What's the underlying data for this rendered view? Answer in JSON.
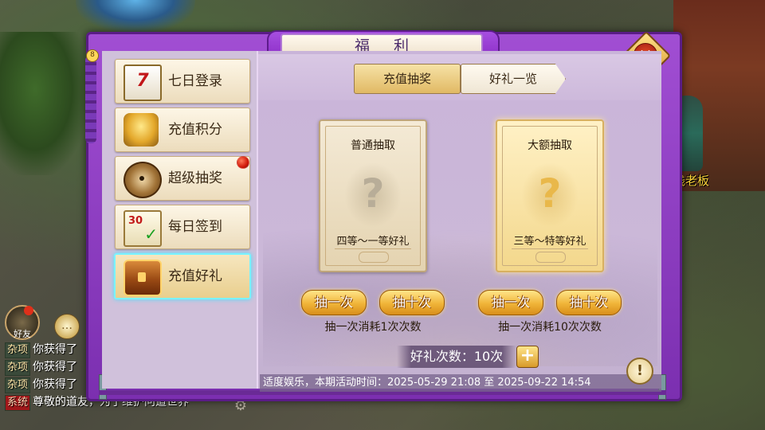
{
  "background": {
    "npc_name": "客栈老板",
    "chat_lines": [
      {
        "tag": "杂项",
        "text": "你获得了"
      },
      {
        "tag": "杂项",
        "text": "你获得了"
      },
      {
        "tag": "杂项",
        "text": "你获得了"
      },
      {
        "tag": "系统",
        "text": "尊敬的道友，为了维护问道世界"
      }
    ],
    "friend_label": "好友"
  },
  "window": {
    "title": "福 利",
    "close_icon": "close-icon",
    "tassel_badge": "8"
  },
  "sidebar": {
    "items": [
      {
        "label": "七日登录",
        "icon": "calendar-7-icon",
        "calendar_text": "7"
      },
      {
        "label": "充值积分",
        "icon": "gold-ingot-icon"
      },
      {
        "label": "超级抽奖",
        "icon": "compass-wheel-icon",
        "has_alert": true
      },
      {
        "label": "每日签到",
        "icon": "sign-in-calendar-icon",
        "calendar_text": "30"
      },
      {
        "label": "充值好礼",
        "icon": "treasure-chest-icon",
        "selected": true
      }
    ]
  },
  "tabs": [
    {
      "label": "充值抽奖",
      "active": true
    },
    {
      "label": "好礼一览",
      "active": false
    }
  ],
  "cards": [
    {
      "title": "普通抽取",
      "subtitle": "四等～一等好礼",
      "question_mark": "?",
      "buttons": [
        "抽一次",
        "抽十次"
      ],
      "cost_text": "抽一次消耗1次次数"
    },
    {
      "title": "大额抽取",
      "subtitle": "三等～特等好礼",
      "question_mark": "?",
      "buttons": [
        "抽一次",
        "抽十次"
      ],
      "cost_text": "抽一次消耗10次次数"
    }
  ],
  "count": {
    "text": "好礼次数：10次",
    "plus": "+"
  },
  "footer": {
    "text": "适度娱乐，本期活动时间：2025-05-29 21:08 至 2025-09-22 14:54",
    "info_button": "!"
  },
  "colors": {
    "panel_purple": "#8a2cc4",
    "active_tab_gold": "#e1b964",
    "selected_glow": "#79f3ff",
    "alert_red": "#d21a0a"
  }
}
